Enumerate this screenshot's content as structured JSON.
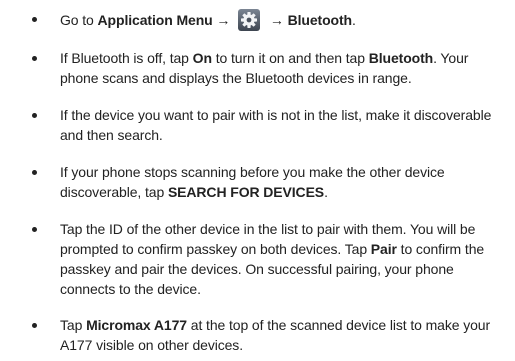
{
  "icons": {
    "settings": "settings-gear-icon"
  },
  "items": [
    {
      "go_to": "Go to ",
      "menu": "Application Menu",
      "arrow1": " → ",
      "arrow2": " → ",
      "target": "Bluetooth",
      "end": "."
    },
    {
      "t1": "If Bluetooth is off, tap ",
      "on": "On",
      "t2": " to turn it on and then tap ",
      "bt": "Bluetooth",
      "t3": ". Your phone scans and displays the Bluetooth devices in range."
    },
    {
      "text": "If the device you want to pair with is not in the list, make it discoverable and then search."
    },
    {
      "t1": "If your phone stops scanning before you make the other device discoverable, tap ",
      "action": "SEARCH FOR DEVICES",
      "t2": "."
    },
    {
      "t1": "Tap the ID of the other device in the list to pair with them. You will be prompted to confirm passkey on both devices. Tap ",
      "pair": "Pair",
      "t2": " to confirm the passkey and pair the devices. On successful pairing, your phone connects to the device."
    },
    {
      "t1": "Tap ",
      "device": "Micromax A177",
      "t2": " at the top of the scanned device list to make your A177 visible on other devices."
    }
  ]
}
